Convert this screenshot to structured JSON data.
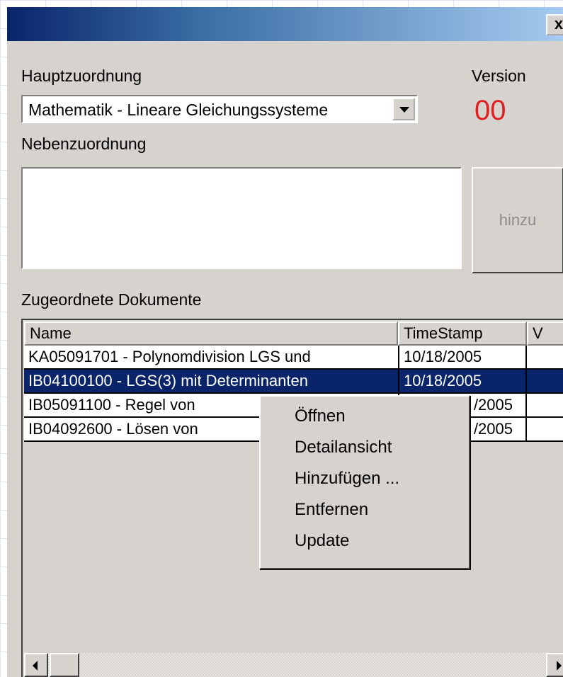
{
  "window": {
    "close_label": "x"
  },
  "main": {
    "primary_label": "Hauptzuordnung",
    "primary_value": "Mathematik - Lineare Gleichungssysteme",
    "version_label": "Version",
    "version_value": "00",
    "secondary_label": "Nebenzuordnung",
    "secondary_value": "",
    "add_button": "hinzu",
    "docs_label": "Zugeordnete Dokumente"
  },
  "table": {
    "columns": [
      "Name",
      "TimeStamp",
      "V"
    ],
    "rows": [
      {
        "name": "KA05091701 - Polynomdivision LGS und",
        "timestamp": "10/18/2005",
        "version": ""
      },
      {
        "name": "IB04100100 - LGS(3) mit Determinanten",
        "timestamp": "10/18/2005",
        "version": ""
      },
      {
        "name": "IB05091100 - Regel von",
        "timestamp": "/2005",
        "version": ""
      },
      {
        "name": "IB04092600 - Lösen von",
        "timestamp": "/2005",
        "version": ""
      }
    ],
    "selected_row": 1
  },
  "context_menu": {
    "items": [
      "Öffnen",
      "Detailansicht",
      "Hinzufügen ...",
      "Entfernen",
      "Update"
    ]
  }
}
